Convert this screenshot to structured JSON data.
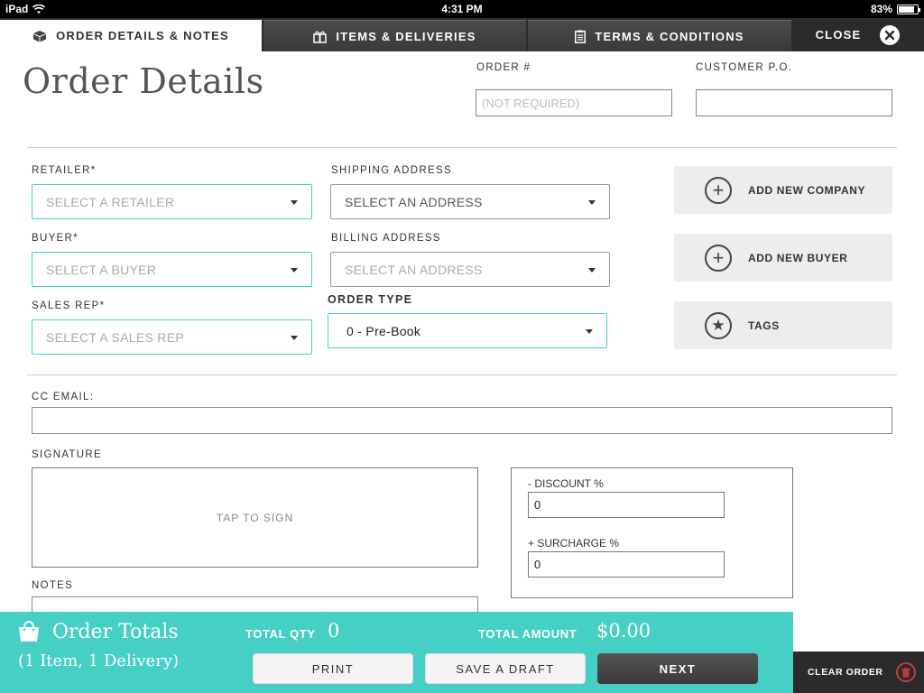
{
  "status_bar": {
    "device": "iPad",
    "time": "4:31 PM",
    "battery": "83%",
    "battery_level": 0.83
  },
  "tabs": [
    {
      "label": "ORDER DETAILS & NOTES",
      "icon": "box-icon",
      "active": true
    },
    {
      "label": "ITEMS & DELIVERIES",
      "icon": "gift-icon",
      "active": false
    },
    {
      "label": "TERMS & CONDITIONS",
      "icon": "clipboard-icon",
      "active": false
    }
  ],
  "close": {
    "label": "CLOSE",
    "icon": "close-circle-icon"
  },
  "header": {
    "title": "Order Details",
    "order_number": {
      "label": "ORDER #",
      "placeholder": "(NOT REQUIRED)",
      "value": ""
    },
    "customer_po": {
      "label": "CUSTOMER P.O.",
      "value": ""
    }
  },
  "form": {
    "retailer": {
      "label": "RETAILER*",
      "placeholder": "SELECT A RETAILER"
    },
    "buyer": {
      "label": "BUYER*",
      "placeholder": "SELECT A BUYER"
    },
    "sales_rep": {
      "label": "SALES REP*",
      "placeholder": "SELECT A SALES REP"
    },
    "shipping_address": {
      "label": "SHIPPING ADDRESS",
      "placeholder": "SELECT AN ADDRESS"
    },
    "billing_address": {
      "label": "BILLING ADDRESS",
      "placeholder": "SELECT AN ADDRESS"
    },
    "order_type": {
      "label": "ORDER TYPE",
      "value": "0 - Pre-Book"
    }
  },
  "side_buttons": [
    {
      "label": "ADD NEW COMPANY",
      "icon": "plus-circle-icon"
    },
    {
      "label": "ADD NEW BUYER",
      "icon": "plus-circle-icon"
    },
    {
      "label": "TAGS",
      "icon": "star-circle-icon"
    }
  ],
  "cc_email": {
    "label": "CC EMAIL:",
    "value": ""
  },
  "signature": {
    "label": "SIGNATURE",
    "placeholder": "TAP TO SIGN"
  },
  "adjustments": {
    "discount": {
      "label": "- DISCOUNT %",
      "value": "0"
    },
    "surcharge": {
      "label": "+ SURCHARGE %",
      "value": "0"
    }
  },
  "notes": {
    "label": "NOTES"
  },
  "footer": {
    "title": "Order Totals",
    "subtitle": "(1 Item, 1 Delivery)",
    "total_qty_label": "TOTAL QTY",
    "total_qty": "0",
    "total_amount_label": "TOTAL AMOUNT",
    "total_amount": "$0.00",
    "buttons": {
      "print": "PRINT",
      "save_draft": "SAVE A DRAFT",
      "next": "NEXT"
    },
    "clear_order": "CLEAR ORDER"
  },
  "colors": {
    "accent": "#45cfc5",
    "dark_bar": "#2b2b2b",
    "danger": "#c23b3b"
  }
}
